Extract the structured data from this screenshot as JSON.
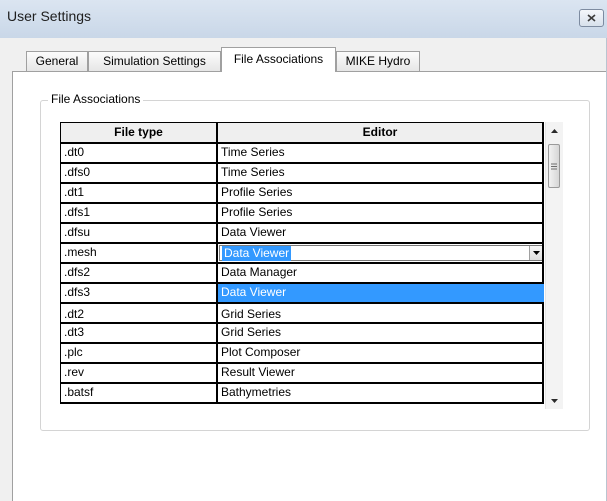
{
  "window": {
    "title": "User Settings"
  },
  "tabs": [
    {
      "label": "General"
    },
    {
      "label": "Simulation Settings"
    },
    {
      "label": "File Associations"
    },
    {
      "label": "MIKE Hydro"
    }
  ],
  "group": {
    "label": "File Associations"
  },
  "grid": {
    "columns": {
      "file_type": "File type",
      "editor": "Editor"
    },
    "rows": [
      {
        "file_type": ".dt0",
        "editor": "Time Series"
      },
      {
        "file_type": ".dfs0",
        "editor": "Time Series"
      },
      {
        "file_type": ".dt1",
        "editor": "Profile Series"
      },
      {
        "file_type": ".dfs1",
        "editor": "Profile Series"
      },
      {
        "file_type": ".dfsu",
        "editor": "Data Viewer"
      },
      {
        "file_type": ".mesh",
        "editor": "Data Viewer"
      },
      {
        "file_type": ".dfs2",
        "editor": "Data Manager"
      },
      {
        "file_type": ".dfs3",
        "editor": "Data Viewer"
      },
      {
        "file_type": ".dt2",
        "editor": "Grid Series"
      },
      {
        "file_type": ".dt3",
        "editor": "Grid Series"
      },
      {
        "file_type": ".plc",
        "editor": "Plot Composer"
      },
      {
        "file_type": ".rev",
        "editor": "Result Viewer"
      },
      {
        "file_type": ".batsf",
        "editor": "Bathymetries"
      }
    ]
  },
  "state": {
    "editing_row": ".mesh",
    "selected_row": ".dfs3"
  },
  "colors": {
    "selection": "#3399ff",
    "tab_background": "#ffffff",
    "dialog_background": "#f0f0f0"
  },
  "icons": {
    "close": "close-x-icon",
    "dropdown": "chevron-down-icon",
    "scroll_up": "scroll-up-arrow-icon",
    "scroll_down": "scroll-down-arrow-icon"
  }
}
